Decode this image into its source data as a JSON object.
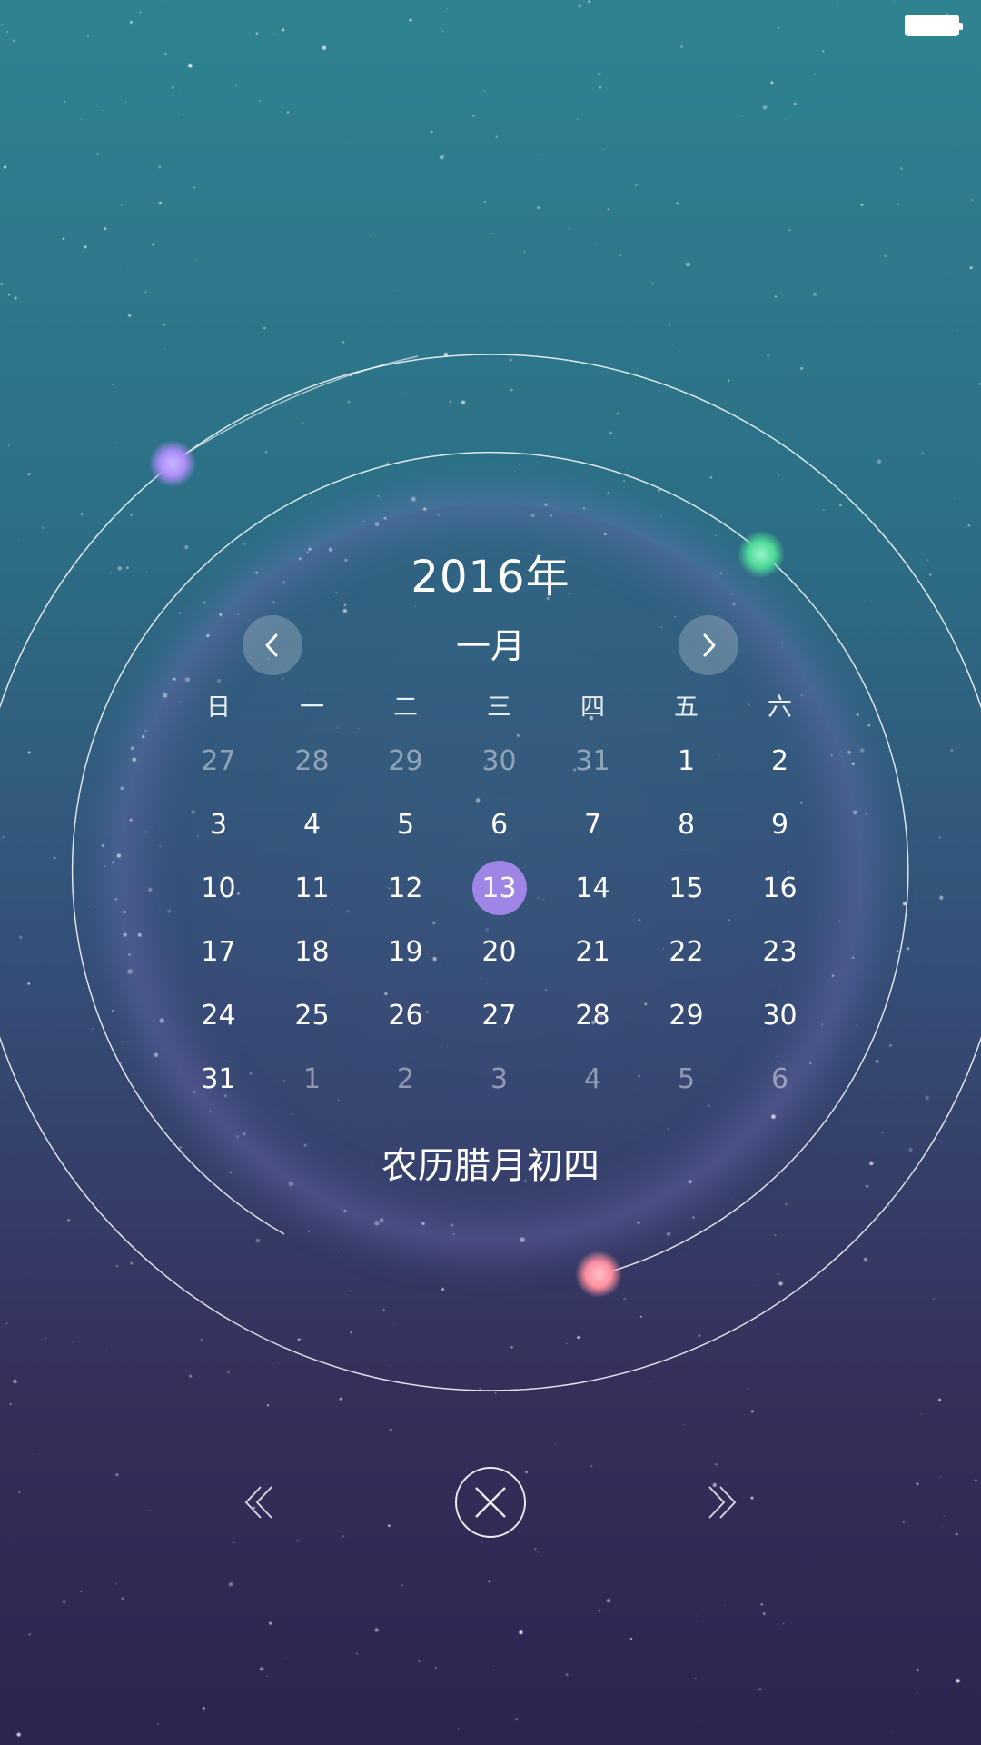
{
  "calendar": {
    "year_label": "2016年",
    "month_label": "一月",
    "weekdays": [
      "日",
      "一",
      "二",
      "三",
      "四",
      "五",
      "六"
    ],
    "weeks": [
      [
        {
          "d": "27",
          "m": true
        },
        {
          "d": "28",
          "m": true
        },
        {
          "d": "29",
          "m": true
        },
        {
          "d": "30",
          "m": true
        },
        {
          "d": "31",
          "m": true
        },
        {
          "d": "1"
        },
        {
          "d": "2"
        }
      ],
      [
        {
          "d": "3"
        },
        {
          "d": "4"
        },
        {
          "d": "5"
        },
        {
          "d": "6"
        },
        {
          "d": "7"
        },
        {
          "d": "8"
        },
        {
          "d": "9"
        }
      ],
      [
        {
          "d": "10"
        },
        {
          "d": "11"
        },
        {
          "d": "12"
        },
        {
          "d": "13",
          "t": true
        },
        {
          "d": "14"
        },
        {
          "d": "15"
        },
        {
          "d": "16"
        }
      ],
      [
        {
          "d": "17"
        },
        {
          "d": "18"
        },
        {
          "d": "19"
        },
        {
          "d": "20"
        },
        {
          "d": "21"
        },
        {
          "d": "22"
        },
        {
          "d": "23"
        }
      ],
      [
        {
          "d": "24"
        },
        {
          "d": "25"
        },
        {
          "d": "26"
        },
        {
          "d": "27"
        },
        {
          "d": "28"
        },
        {
          "d": "29"
        },
        {
          "d": "30"
        }
      ],
      [
        {
          "d": "31"
        },
        {
          "d": "1",
          "m": true
        },
        {
          "d": "2",
          "m": true
        },
        {
          "d": "3",
          "m": true
        },
        {
          "d": "4",
          "m": true
        },
        {
          "d": "5",
          "m": true
        },
        {
          "d": "6",
          "m": true
        }
      ]
    ],
    "lunar_label": "农历腊月初四",
    "selected_day": "13"
  },
  "icons": {
    "prev_month": "chevron-left-icon",
    "next_month": "chevron-right-icon",
    "prev_year": "double-chevron-left-icon",
    "next_year": "double-chevron-right-icon",
    "close": "close-circle-icon",
    "battery": "battery-icon"
  },
  "colors": {
    "today_highlight": "#9f86e6",
    "orb_purple": "#b39cff",
    "orb_green": "#5ee0a6",
    "orb_pink": "#ff9aa8"
  }
}
